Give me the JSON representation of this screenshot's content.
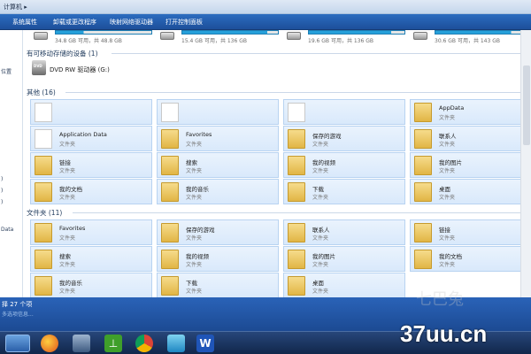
{
  "window": {
    "breadcrumb": "计算机 ▸"
  },
  "commandbar": [
    "系统属性",
    "卸载或更改程序",
    "映射网络驱动器",
    "打开控制面板"
  ],
  "nav": {
    "items": [
      "位置",
      ")",
      ")",
      ")",
      "Data"
    ]
  },
  "drives": [
    {
      "info": "34.8 GB 可用，共 48.8 GB",
      "fill": 0.29
    },
    {
      "info": "15.4 GB 可用，共 136 GB",
      "fill": 0.89
    },
    {
      "info": "19.6 GB 可用，共 136 GB",
      "fill": 0.86
    },
    {
      "info": "30.6 GB 可用，共 143 GB",
      "fill": 0.79
    }
  ],
  "groups": {
    "removable": {
      "title": "有可移动存储的设备 (1)"
    },
    "other": {
      "title": "其他 (16)"
    },
    "folders": {
      "title": "文件夹 (11)"
    }
  },
  "dvd": {
    "label": "DVD RW 驱动器 (G:)"
  },
  "other_items": [
    {
      "name": "",
      "type": "",
      "icon": "page"
    },
    {
      "name": "",
      "type": "",
      "icon": "page"
    },
    {
      "name": "",
      "type": "",
      "icon": "page"
    },
    {
      "name": "AppData",
      "type": "文件夹",
      "icon": "folder"
    },
    {
      "name": "Application Data",
      "type": "文件夹",
      "icon": "page"
    },
    {
      "name": "Favorites",
      "type": "文件夹",
      "icon": "folder"
    },
    {
      "name": "保存的游戏",
      "type": "文件夹",
      "icon": "folder"
    },
    {
      "name": "联系人",
      "type": "文件夹",
      "icon": "folder"
    },
    {
      "name": "链接",
      "type": "文件夹",
      "icon": "folder"
    },
    {
      "name": "搜索",
      "type": "文件夹",
      "icon": "folder"
    },
    {
      "name": "我的视频",
      "type": "文件夹",
      "icon": "folder"
    },
    {
      "name": "我的图片",
      "type": "文件夹",
      "icon": "folder"
    },
    {
      "name": "我的文档",
      "type": "文件夹",
      "icon": "folder"
    },
    {
      "name": "我的音乐",
      "type": "文件夹",
      "icon": "folder"
    },
    {
      "name": "下载",
      "type": "文件夹",
      "icon": "folder"
    },
    {
      "name": "桌面",
      "type": "文件夹",
      "icon": "folder"
    }
  ],
  "folder_items": [
    {
      "name": "Favorites",
      "type": "文件夹"
    },
    {
      "name": "保存的游戏",
      "type": "文件夹"
    },
    {
      "name": "联系人",
      "type": "文件夹"
    },
    {
      "name": "链接",
      "type": "文件夹"
    },
    {
      "name": "搜索",
      "type": "文件夹"
    },
    {
      "name": "我的视频",
      "type": "文件夹"
    },
    {
      "name": "我的图片",
      "type": "文件夹"
    },
    {
      "name": "我的文档",
      "type": "文件夹"
    },
    {
      "name": "我的音乐",
      "type": "文件夹"
    },
    {
      "name": "下载",
      "type": "文件夹"
    },
    {
      "name": "桌面",
      "type": "文件夹"
    }
  ],
  "status": {
    "count": "择 27 个项",
    "selected": "多选项信息..."
  },
  "taskbar": [
    "start-orb",
    "explorer",
    "firefox",
    "monitor",
    "utorrent",
    "chrome",
    "shield",
    "wps"
  ],
  "watermark": {
    "text": "37uu.cn",
    "logo": "七巴兔"
  }
}
